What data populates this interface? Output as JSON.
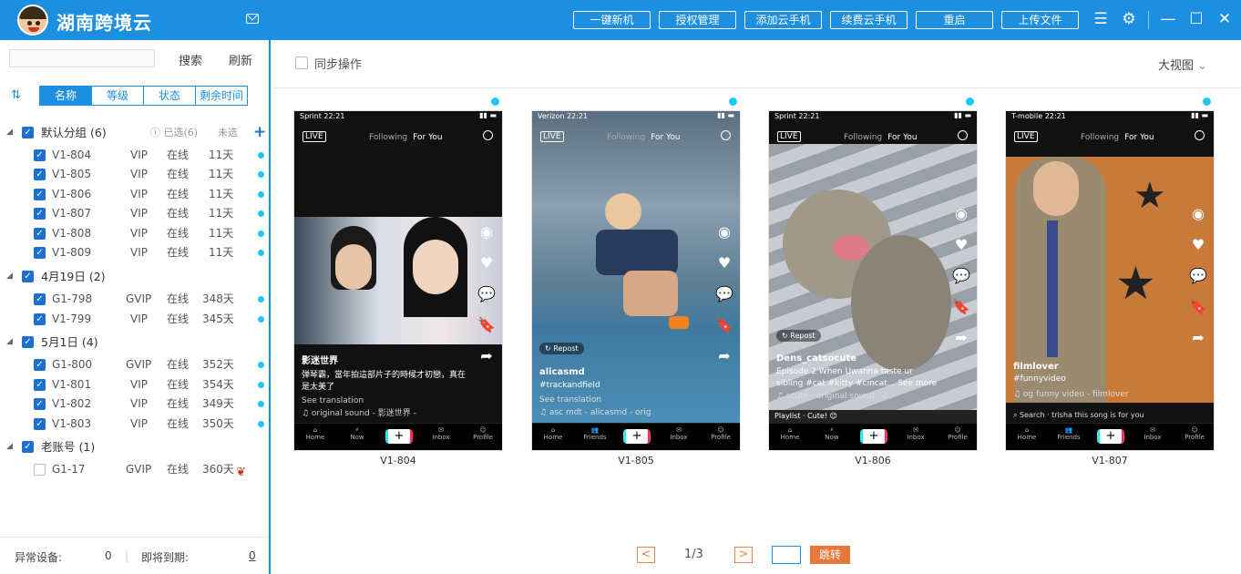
{
  "app": {
    "title": "湖南跨境云"
  },
  "toolbar": {
    "buttons": [
      "一键新机",
      "授权管理",
      "添加云手机",
      "续费云手机",
      "重启",
      "上传文件"
    ]
  },
  "sidebar": {
    "search_button": "搜索",
    "refresh_button": "刷新",
    "filter_tabs": [
      "名称",
      "等级",
      "状态",
      "剩余时间"
    ],
    "groups": [
      {
        "name": "默认分组",
        "count": "(6)",
        "selected_hint": "已选(6)",
        "unselected": "未选",
        "devices": [
          {
            "name": "V1-804",
            "level": "VIP",
            "status": "在线",
            "days": "11天"
          },
          {
            "name": "V1-805",
            "level": "VIP",
            "status": "在线",
            "days": "11天"
          },
          {
            "name": "V1-806",
            "level": "VIP",
            "status": "在线",
            "days": "11天"
          },
          {
            "name": "V1-807",
            "level": "VIP",
            "status": "在线",
            "days": "11天"
          },
          {
            "name": "V1-808",
            "level": "VIP",
            "status": "在线",
            "days": "11天"
          },
          {
            "name": "V1-809",
            "level": "VIP",
            "status": "在线",
            "days": "11天"
          }
        ]
      },
      {
        "name": "4月19日",
        "count": "(2)",
        "devices": [
          {
            "name": "G1-798",
            "level": "GVIP",
            "status": "在线",
            "days": "348天"
          },
          {
            "name": "V1-799",
            "level": "VIP",
            "status": "在线",
            "days": "345天"
          }
        ]
      },
      {
        "name": "5月1日",
        "count": "(4)",
        "devices": [
          {
            "name": "G1-800",
            "level": "GVIP",
            "status": "在线",
            "days": "352天"
          },
          {
            "name": "V1-801",
            "level": "VIP",
            "status": "在线",
            "days": "354天"
          },
          {
            "name": "V1-802",
            "level": "VIP",
            "status": "在线",
            "days": "349天"
          },
          {
            "name": "V1-803",
            "level": "VIP",
            "status": "在线",
            "days": "350天"
          }
        ]
      },
      {
        "name": "老账号",
        "count": "(1)",
        "devices": [
          {
            "name": "G1-17",
            "level": "GVIP",
            "status": "在线",
            "days": "360天"
          }
        ]
      }
    ],
    "footer": {
      "abnormal_label": "异常设备:",
      "abnormal_count": "0",
      "expiring_label": "即将到期:",
      "expiring_count": "0"
    }
  },
  "main": {
    "sync_label": "同步操作",
    "view_mode": "大视图",
    "phones": [
      {
        "label": "V1-804",
        "carrier": "Sprint 22:21",
        "caption_title": "影迷世界",
        "caption": "弹琴霸，當年拍這部片子的時候才初戀，真在是太美了",
        "translate": "See translation",
        "sound": "♫ original sound - 影迷世界 -",
        "likes": "46.9K"
      },
      {
        "label": "V1-805",
        "carrier": "Verizon 22:21",
        "caption_title": "alicasmd",
        "caption": "#trackandfield",
        "translate": "See translation",
        "sound": "♫ asc mdt - alicasmd - orig",
        "likes": "2.8M",
        "repost": "Repost"
      },
      {
        "label": "V1-806",
        "carrier": "Sprint 22:21",
        "caption_title": "Dens_catsocute",
        "caption": "Episode 2 When Uwanna taste ur sibling #cat #kitty #cincat... See more",
        "sound": "♫ scute · original sound · d·",
        "likes": "309.5K",
        "repost": "Repost",
        "playlist": "Playlist · Cute! 😊"
      },
      {
        "label": "V1-807",
        "carrier": "T-mobile 22:21",
        "caption_title": "filmlover",
        "caption": "#funnyvideo",
        "sound": "♫ og funny video - filmlover",
        "likes": "",
        "search_hint": "Search · trisha this song is for you"
      }
    ],
    "feed_tabs": {
      "following": "Following",
      "for_you": "For You"
    },
    "nav": [
      "Home",
      "Now",
      "Inbox",
      "Profile"
    ],
    "nav_friends": "Friends",
    "pagination": {
      "text": "1/3",
      "jump": "跳转",
      "prev": "<",
      "next": ">"
    }
  }
}
